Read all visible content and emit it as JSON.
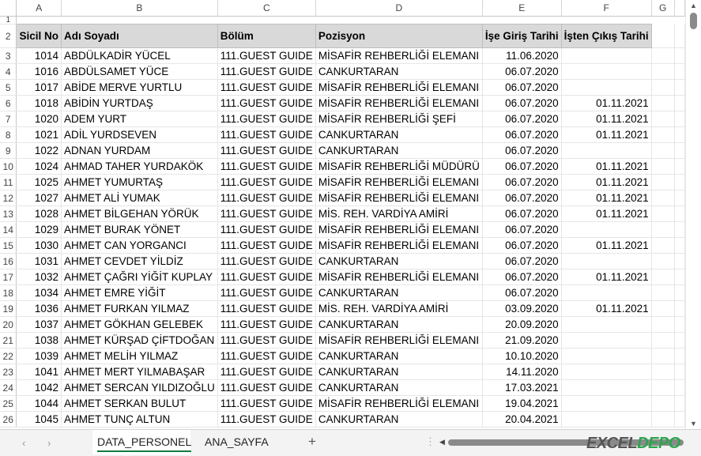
{
  "columns": [
    "A",
    "B",
    "C",
    "D",
    "E",
    "F",
    "G"
  ],
  "header_row": {
    "num": "2",
    "cells": [
      "Sicil No",
      "Adı Soyadı",
      "Bölüm",
      "Pozisyon",
      "İşe Giriş Tarihi",
      "İşten Çıkış Tarihi",
      ""
    ]
  },
  "first_row_num": "1",
  "rows": [
    {
      "r": "3",
      "sicil": "1014",
      "ad": "ABDÜLKADİR YÜCEL",
      "bolum": "111.GUEST GUIDE",
      "poz": "MİSAFİR REHBERLİĞİ ELEMANI",
      "giris": "11.06.2020",
      "cikis": ""
    },
    {
      "r": "4",
      "sicil": "1016",
      "ad": "ABDÜLSAMET YÜCE",
      "bolum": "111.GUEST GUIDE",
      "poz": "CANKURTARAN",
      "giris": "06.07.2020",
      "cikis": ""
    },
    {
      "r": "5",
      "sicil": "1017",
      "ad": "ABİDE MERVE YURTLU",
      "bolum": "111.GUEST GUIDE",
      "poz": "MİSAFİR REHBERLİĞİ ELEMANI",
      "giris": "06.07.2020",
      "cikis": ""
    },
    {
      "r": "6",
      "sicil": "1018",
      "ad": "ABİDİN YURTDAŞ",
      "bolum": "111.GUEST GUIDE",
      "poz": "MİSAFİR REHBERLİĞİ ELEMANI",
      "giris": "06.07.2020",
      "cikis": "01.11.2021"
    },
    {
      "r": "7",
      "sicil": "1020",
      "ad": "ADEM YURT",
      "bolum": "111.GUEST GUIDE",
      "poz": "MİSAFİR REHBERLİĞİ ŞEFİ",
      "giris": "06.07.2020",
      "cikis": "01.11.2021"
    },
    {
      "r": "8",
      "sicil": "1021",
      "ad": "ADİL YURDSEVEN",
      "bolum": "111.GUEST GUIDE",
      "poz": "CANKURTARAN",
      "giris": "06.07.2020",
      "cikis": "01.11.2021"
    },
    {
      "r": "9",
      "sicil": "1022",
      "ad": "ADNAN YURDAM",
      "bolum": "111.GUEST GUIDE",
      "poz": "CANKURTARAN",
      "giris": "06.07.2020",
      "cikis": ""
    },
    {
      "r": "10",
      "sicil": "1024",
      "ad": "AHMAD TAHER YURDAKÖK",
      "bolum": "111.GUEST GUIDE",
      "poz": "MİSAFİR REHBERLİĞİ MÜDÜRÜ",
      "giris": "06.07.2020",
      "cikis": "01.11.2021"
    },
    {
      "r": "11",
      "sicil": "1025",
      "ad": "AHMET YUMURTAŞ",
      "bolum": "111.GUEST GUIDE",
      "poz": "MİSAFİR REHBERLİĞİ ELEMANI",
      "giris": "06.07.2020",
      "cikis": "01.11.2021"
    },
    {
      "r": "12",
      "sicil": "1027",
      "ad": "AHMET ALİ YUMAK",
      "bolum": "111.GUEST GUIDE",
      "poz": "MİSAFİR REHBERLİĞİ ELEMANI",
      "giris": "06.07.2020",
      "cikis": "01.11.2021"
    },
    {
      "r": "13",
      "sicil": "1028",
      "ad": "AHMET BİLGEHAN YÖRÜK",
      "bolum": "111.GUEST GUIDE",
      "poz": "MİS. REH. VARDİYA AMİRİ",
      "giris": "06.07.2020",
      "cikis": "01.11.2021"
    },
    {
      "r": "14",
      "sicil": "1029",
      "ad": "AHMET BURAK YÖNET",
      "bolum": "111.GUEST GUIDE",
      "poz": "MİSAFİR REHBERLİĞİ ELEMANI",
      "giris": "06.07.2020",
      "cikis": ""
    },
    {
      "r": "15",
      "sicil": "1030",
      "ad": "AHMET CAN YORGANCI",
      "bolum": "111.GUEST GUIDE",
      "poz": "MİSAFİR REHBERLİĞİ ELEMANI",
      "giris": "06.07.2020",
      "cikis": "01.11.2021"
    },
    {
      "r": "16",
      "sicil": "1031",
      "ad": "AHMET CEVDET YİLDİZ",
      "bolum": "111.GUEST GUIDE",
      "poz": "CANKURTARAN",
      "giris": "06.07.2020",
      "cikis": ""
    },
    {
      "r": "17",
      "sicil": "1032",
      "ad": "AHMET ÇAĞRI YİĞİT KUPLAY",
      "bolum": "111.GUEST GUIDE",
      "poz": "MİSAFİR REHBERLİĞİ ELEMANI",
      "giris": "06.07.2020",
      "cikis": "01.11.2021"
    },
    {
      "r": "18",
      "sicil": "1034",
      "ad": "AHMET EMRE YİĞİT",
      "bolum": "111.GUEST GUIDE",
      "poz": "CANKURTARAN",
      "giris": "06.07.2020",
      "cikis": ""
    },
    {
      "r": "19",
      "sicil": "1036",
      "ad": "AHMET FURKAN YILMAZ",
      "bolum": "111.GUEST GUIDE",
      "poz": "MİS. REH. VARDİYA AMİRİ",
      "giris": "03.09.2020",
      "cikis": "01.11.2021"
    },
    {
      "r": "20",
      "sicil": "1037",
      "ad": "AHMET GÖKHAN GELEBEK",
      "bolum": "111.GUEST GUIDE",
      "poz": "CANKURTARAN",
      "giris": "20.09.2020",
      "cikis": ""
    },
    {
      "r": "21",
      "sicil": "1038",
      "ad": "AHMET KÜRŞAD ÇİFTDOĞAN",
      "bolum": "111.GUEST GUIDE",
      "poz": "MİSAFİR REHBERLİĞİ ELEMANI",
      "giris": "21.09.2020",
      "cikis": ""
    },
    {
      "r": "22",
      "sicil": "1039",
      "ad": "AHMET MELİH YILMAZ",
      "bolum": "111.GUEST GUIDE",
      "poz": "CANKURTARAN",
      "giris": "10.10.2020",
      "cikis": ""
    },
    {
      "r": "23",
      "sicil": "1041",
      "ad": "AHMET MERT YILMABAŞAR",
      "bolum": "111.GUEST GUIDE",
      "poz": "CANKURTARAN",
      "giris": "14.11.2020",
      "cikis": ""
    },
    {
      "r": "24",
      "sicil": "1042",
      "ad": "AHMET SERCAN YILDIZOĞLU",
      "bolum": "111.GUEST GUIDE",
      "poz": "CANKURTARAN",
      "giris": "17.03.2021",
      "cikis": ""
    },
    {
      "r": "25",
      "sicil": "1044",
      "ad": "AHMET SERKAN BULUT",
      "bolum": "111.GUEST GUIDE",
      "poz": "MİSAFİR REHBERLİĞİ ELEMANI",
      "giris": "19.04.2021",
      "cikis": ""
    },
    {
      "r": "26",
      "sicil": "1045",
      "ad": "AHMET TUNÇ ALTUN",
      "bolum": "111.GUEST GUIDE",
      "poz": "CANKURTARAN",
      "giris": "20.04.2021",
      "cikis": ""
    }
  ],
  "tabs": [
    {
      "label": "DATA_PERSONEL",
      "active": true
    },
    {
      "label": "ANA_SAYFA",
      "active": false
    }
  ],
  "nav": {
    "prev": "‹",
    "next": "›",
    "add": "+"
  },
  "logo": {
    "part1": "EXCEL",
    "part2": "DEPO"
  },
  "colors": {
    "header_fill": "#d9d9d9",
    "active_tab_accent": "#107c41",
    "logo_green": "#2da44e"
  }
}
